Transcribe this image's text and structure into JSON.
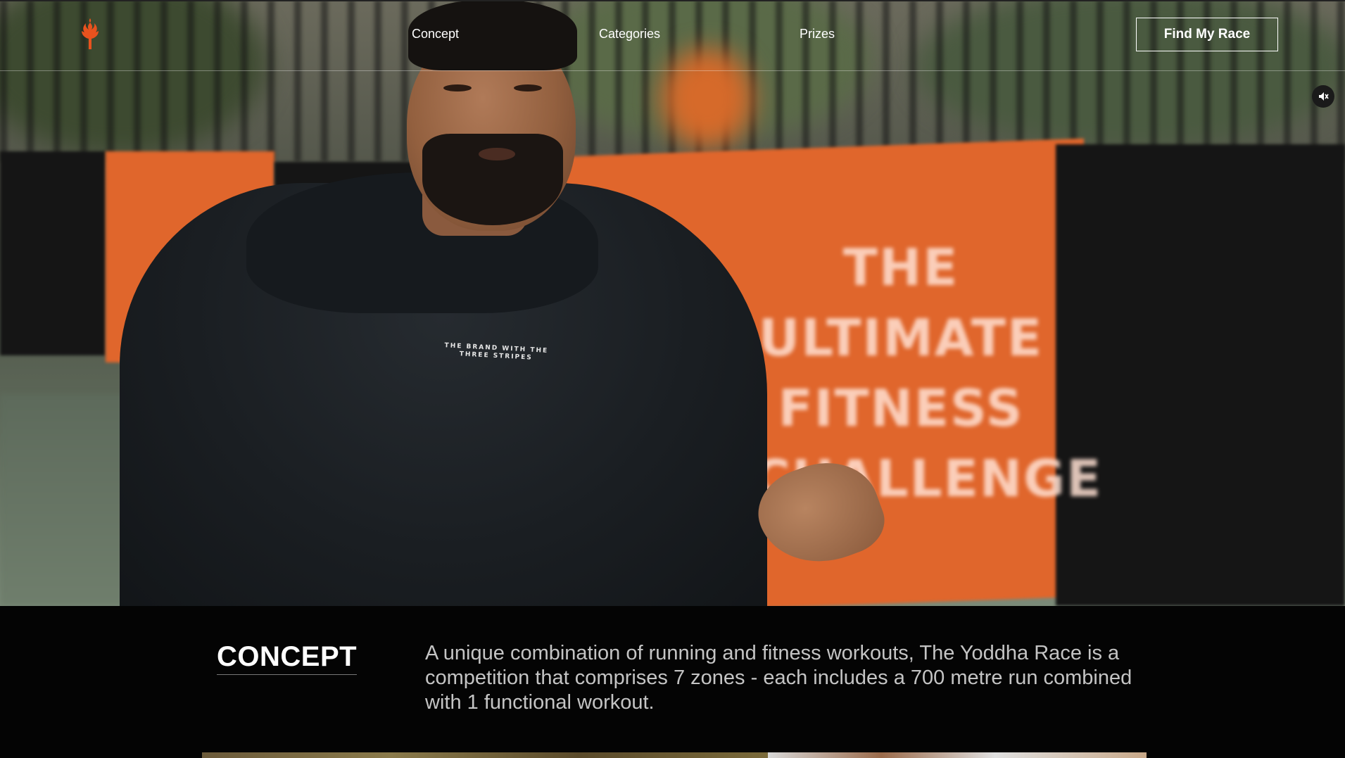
{
  "nav": {
    "links": [
      {
        "label": "Concept"
      },
      {
        "label": "Categories"
      },
      {
        "label": "Prizes"
      }
    ],
    "cta_label": "Find My Race",
    "brand_color": "#e8521e"
  },
  "hero": {
    "banner_text": "THE ULTIMATE FITNESS CHALLENGE",
    "shirt_print": "THE BRAND WITH THE THREE STRIPES",
    "mute_icon": "volume-muted-icon"
  },
  "concept": {
    "title": "CONCEPT",
    "description": "A unique combination of running and fitness workouts, The Yoddha Race is a competition that comprises 7 zones - each includes a 700 metre run combined with 1 functional workout."
  },
  "colors": {
    "accent": "#e8521e",
    "banner_orange": "#e0662c",
    "background": "#040404",
    "body_text": "#c4c4c4"
  }
}
